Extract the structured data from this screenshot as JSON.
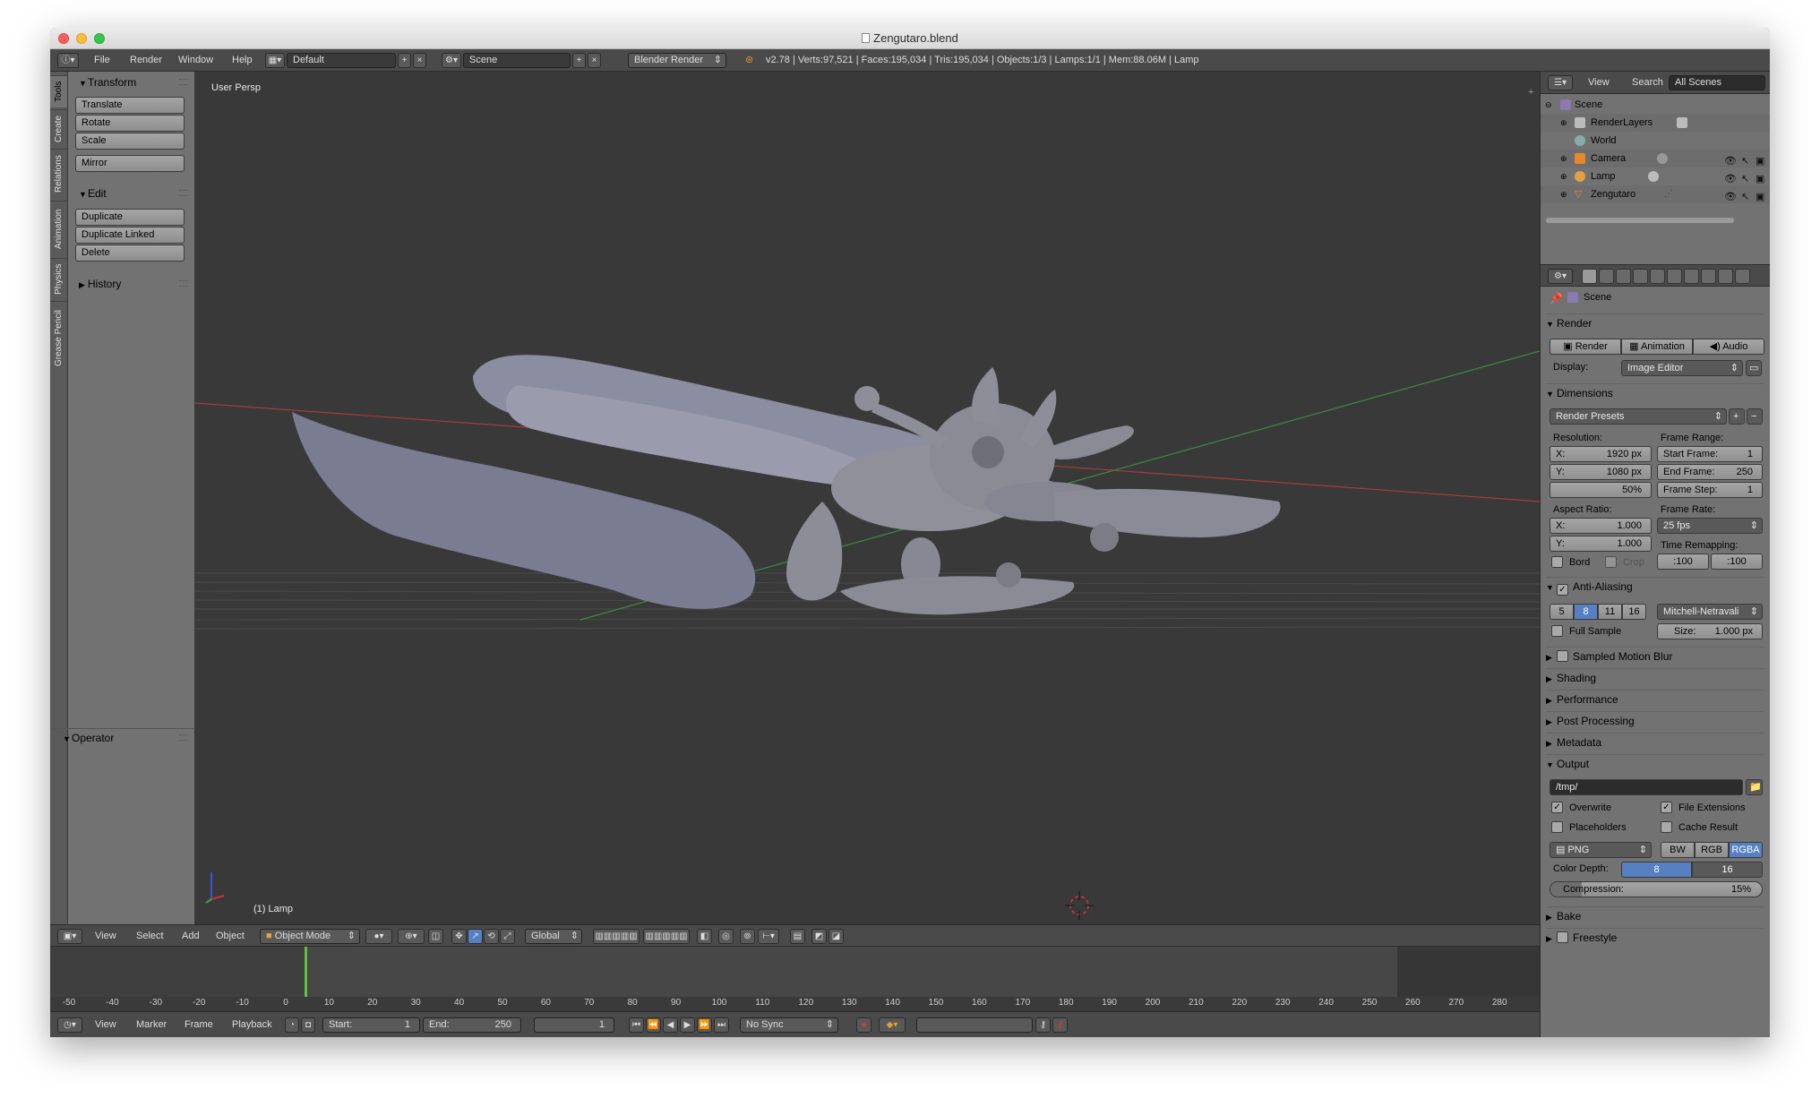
{
  "window": {
    "title": "Zengutaro.blend"
  },
  "infobar": {
    "menus": [
      "File",
      "Render",
      "Window",
      "Help"
    ],
    "layout": "Default",
    "scene": "Scene",
    "engine": "Blender Render",
    "stats": "v2.78 | Verts:97,521 | Faces:195,034 | Tris:195,034 | Objects:1/3 | Lamps:1/1 | Mem:88.06M | Lamp"
  },
  "tool_tabs": [
    "Tools",
    "Create",
    "Relations",
    "Animation",
    "Physics",
    "Grease Pencil"
  ],
  "tool_shelf": {
    "transform_title": "Transform",
    "transform_buttons": [
      "Translate",
      "Rotate",
      "Scale",
      "Mirror"
    ],
    "edit_title": "Edit",
    "edit_buttons": [
      "Duplicate",
      "Duplicate Linked",
      "Delete"
    ],
    "history_title": "History",
    "operator_title": "Operator"
  },
  "viewport": {
    "view_label": "User Persp",
    "object_label": "(1) Lamp",
    "colors": {
      "background": "#393939",
      "mesh": "#8a8c9a",
      "x_axis": "#a83a3a",
      "y_axis": "#3f8a3f"
    }
  },
  "view3d_header": {
    "menus": [
      "View",
      "Select",
      "Add",
      "Object"
    ],
    "mode": "Object Mode",
    "orientation": "Global"
  },
  "timeline": {
    "ticks": [
      "-50",
      "-40",
      "-30",
      "-20",
      "-10",
      "0",
      "10",
      "20",
      "30",
      "40",
      "50",
      "60",
      "70",
      "80",
      "90",
      "100",
      "110",
      "120",
      "130",
      "140",
      "150",
      "160",
      "170",
      "180",
      "190",
      "200",
      "210",
      "220",
      "230",
      "240",
      "250",
      "260",
      "270",
      "280"
    ],
    "menus": [
      "View",
      "Marker",
      "Frame",
      "Playback"
    ],
    "start_label": "Start:",
    "start_value": "1",
    "end_label": "End:",
    "end_value": "250",
    "current_frame": "1",
    "sync": "No Sync"
  },
  "outliner": {
    "header": {
      "view": "View",
      "search": "Search",
      "filter": "All Scenes"
    },
    "items": [
      "Scene",
      "RenderLayers",
      "World",
      "Camera",
      "Lamp",
      "Zengutaro"
    ]
  },
  "properties": {
    "context": "Scene",
    "render_section": "Render",
    "render_buttons": [
      "Render",
      "Animation",
      "Audio"
    ],
    "display_label": "Display:",
    "display_value": "Image Editor",
    "dimensions_section": "Dimensions",
    "render_presets": "Render Presets",
    "resolution_label": "Resolution:",
    "res_x": "X:",
    "res_x_value": "1920 px",
    "res_y": "Y:",
    "res_y_value": "1080 px",
    "res_pct": "50%",
    "frame_range_label": "Frame Range:",
    "start_frame": "Start Frame:",
    "start_frame_value": "1",
    "end_frame": "End Frame:",
    "end_frame_value": "250",
    "frame_step": "Frame Step:",
    "frame_step_value": "1",
    "aspect_label": "Aspect Ratio:",
    "aspect_x": "X:",
    "aspect_x_value": "1.000",
    "aspect_y": "Y:",
    "aspect_y_value": "1.000",
    "frame_rate_label": "Frame Rate:",
    "frame_rate_value": "25 fps",
    "time_remap_label": "Time Remapping:",
    "remap_old": ":100",
    "remap_new": ":100",
    "bord": "Bord",
    "crop": "Crop",
    "aa_section": "Anti-Aliasing",
    "aa_samples": [
      "5",
      "8",
      "11",
      "16"
    ],
    "aa_filter": "Mitchell-Netravali",
    "full_sample": "Full Sample",
    "size_label": "Size:",
    "size_value": "1.000 px",
    "collapsed_sections": [
      "Sampled Motion Blur",
      "Shading",
      "Performance",
      "Post Processing",
      "Metadata"
    ],
    "output_section": "Output",
    "output_path": "/tmp/",
    "overwrite": "Overwrite",
    "file_extensions": "File Extensions",
    "placeholders": "Placeholders",
    "cache_result": "Cache Result",
    "format": "PNG",
    "color_modes": [
      "BW",
      "RGB",
      "RGBA"
    ],
    "color_depth_label": "Color Depth:",
    "color_depths": [
      "8",
      "16"
    ],
    "compression_label": "Compression:",
    "compression_value": "15%",
    "compression_fraction": 0.15,
    "bake_section": "Bake",
    "freestyle_section": "Freestyle",
    "accent": "#5680c2"
  }
}
